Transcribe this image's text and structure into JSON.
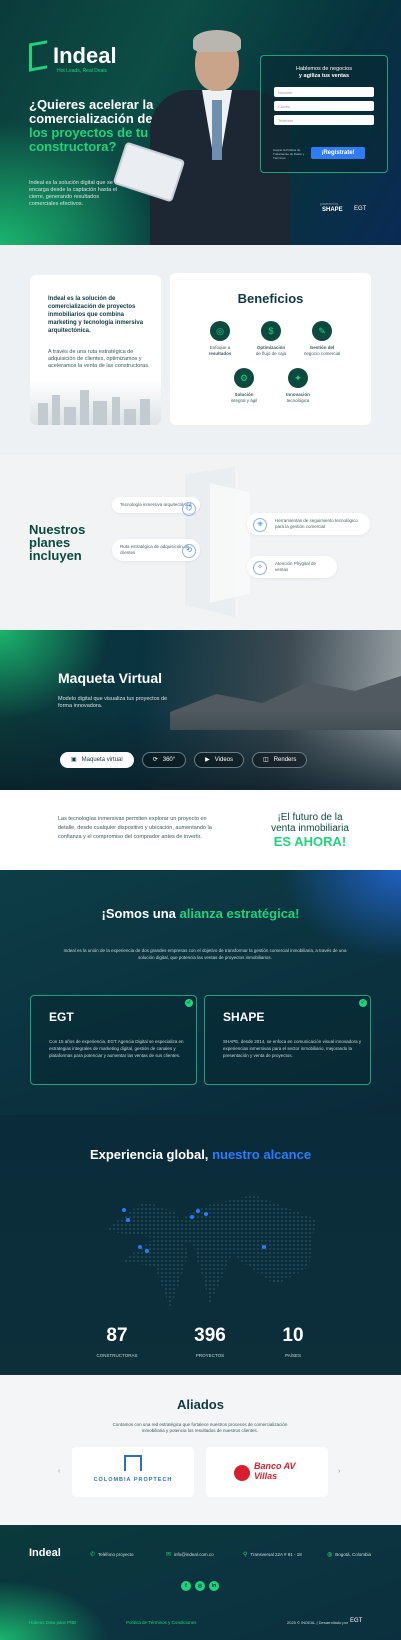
{
  "hero": {
    "brand": "Indeal",
    "tagline": "Hot Leads, Real Deals",
    "headline_white": "¿Quieres acelerar la comercialización de",
    "headline_green": "los proyectos de tu constructora?",
    "desc": "Indeal es la solución digital que se encarga desde la captación hasta el cierre, generando resultados comerciales efectivos.",
    "form_title_1": "Hablemos de negocios",
    "form_title_2": "y agiliza tus ventas",
    "field_1": "Nombre",
    "field_2": "Correo",
    "field_3": "Teléfono",
    "form_note": "Acepto la Política de Tratamiento de Datos y Términos",
    "submit": "¡Regístrate!",
    "powered": "powered by",
    "partner_1": "SHAPE",
    "partner_2": "EGT"
  },
  "about": {
    "title": "Indeal es la solución de comercialización de proyectos inmobiliarios que combina marketing y tecnología inmersiva arquitectónica.",
    "body": "A través de una ruta estratégica de adquisición de clientes, optimizamos y aceleramos la venta de las constructoras.",
    "benefits_title": "Beneficios",
    "benefits": [
      {
        "icon": "target-icon",
        "glyph": "◎",
        "t1": "Enfoque a",
        "t2": "resultados"
      },
      {
        "icon": "cash-flow-icon",
        "glyph": "$",
        "t1": "Optimización",
        "t2": "de flujo de caja"
      },
      {
        "icon": "negotiation-icon",
        "glyph": "✎",
        "t1": "Gestión del",
        "t2": "negocio comercial"
      },
      {
        "icon": "solution-icon",
        "glyph": "⚙",
        "t1": "Solución",
        "t2": "integral y ágil"
      },
      {
        "icon": "innovation-icon",
        "glyph": "✦",
        "t1": "Innovación",
        "t2": "tecnológica"
      }
    ]
  },
  "planes": {
    "title_1": "Nuestros",
    "title_2": "planes",
    "title_3": "incluyen",
    "items": [
      {
        "icon": "vr-icon",
        "glyph": "⌬",
        "text": "Tecnología inmersiva arquitectónica"
      },
      {
        "icon": "handshake-icon",
        "glyph": "⟲",
        "text": "Ruta estratégica de adquisición de clientes"
      },
      {
        "icon": "crm-icon",
        "glyph": "⎈",
        "text": "Herramientas de seguimiento tecnológico para la gestión comercial"
      },
      {
        "icon": "phygital-icon",
        "glyph": "✧",
        "text": "Atención Phygital de ventas"
      }
    ]
  },
  "maqueta": {
    "title": "Maqueta Virtual",
    "desc": "Modelo digital que visualiza tus proyectos de forma innovadora.",
    "tabs": [
      "Maqueta virtual",
      "360°",
      "Videos",
      "Renders"
    ]
  },
  "futuro": {
    "text": "Las tecnologías inmersivas permiten explorar un proyecto en detalle, desde cualquier dispositivo y ubicación, aumentando la confianza y el compromiso del comprador antes de invertir.",
    "line_1": "¡El futuro de la",
    "line_2": "venta inmobiliaria",
    "line_3": "ES AHORA!"
  },
  "alianza": {
    "title_white": "¡Somos una",
    "title_green": "alianza estratégica!",
    "lead": "Indeal es la unión de la experiencia de dos grandes empresas con el objetivo de transformar la gestión comercial inmobiliaria, a través de una solución digital, que potencia las ventas de proyectos inmobiliarios.",
    "cards": [
      {
        "logo": "EGT",
        "text": "Con 15 años de experiencia, EGT Agencia Digital se especializa en estrategias integrales de marketing digital, gestión de canales y plataformas para potenciar y aumentar las ventas de sus clientes."
      },
      {
        "logo": "SHAPE",
        "text": "SHAPE, desde 2014, se enfoca en comunicación visual innovadora y experiencias inmersivas para el sector inmobiliario, mejorando la presentación y venta de proyectos."
      }
    ]
  },
  "global": {
    "title_white": "Experiencia global,",
    "title_blue": "nuestro alcance",
    "stats": [
      {
        "n": "87",
        "l": "CONSTRUCTORAS"
      },
      {
        "n": "396",
        "l": "PROYECTOS"
      },
      {
        "n": "10",
        "l": "PAÍSES"
      }
    ]
  },
  "aliados": {
    "title": "Aliados",
    "desc": "Contamos con una red estratégica que fortalece nuestros procesos de comercialización inmobiliaria y potencia los resultados de nuestros clientes.",
    "logos": [
      "COLOMBIA PROPTECH",
      "Banco AV Villas"
    ]
  },
  "footer": {
    "brand": "Indeal",
    "items": [
      {
        "icon": "phone-icon",
        "glyph": "✆",
        "text": "Teléfono proyecto"
      },
      {
        "icon": "mail-icon",
        "glyph": "✉",
        "text": "info@indeal.com.co"
      },
      {
        "icon": "location-icon",
        "glyph": "⚲",
        "text": "Transversal 22A # 81 - 18"
      },
      {
        "icon": "globe-icon",
        "glyph": "◍",
        "text": "Bogotá, Colombia"
      }
    ],
    "social": [
      {
        "icon": "facebook-icon",
        "glyph": "f"
      },
      {
        "icon": "instagram-icon",
        "glyph": "◎"
      },
      {
        "icon": "linkedin-icon",
        "glyph": "in"
      }
    ],
    "link_1": "Habeas Data para PNB",
    "link_2": "Política de Términos y Condiciones",
    "rights": "2025 © INDEAL | Desarrollado por",
    "dev": "EGT"
  },
  "colors": {
    "accent": "#1fd37a",
    "blue": "#2b7bff",
    "dark": "#072a35"
  }
}
